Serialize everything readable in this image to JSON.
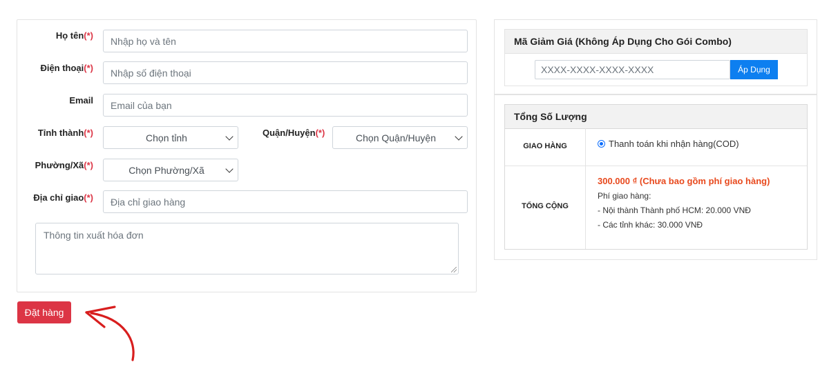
{
  "form": {
    "name_label": "Họ tên",
    "name_placeholder": "Nhập họ và tên",
    "phone_label": "Điện thoại",
    "phone_placeholder": "Nhập số điện thoại",
    "email_label": "Email",
    "email_placeholder": "Email của bạn",
    "province_label": "Tỉnh thành",
    "province_value": "Chọn tỉnh",
    "district_label": "Quận/Huyện",
    "district_value": "Chọn Quận/Huyện",
    "ward_label": "Phường/Xã",
    "ward_value": "Chọn Phường/Xã",
    "address_label": "Địa chỉ giao",
    "address_placeholder": "Địa chỉ giao hàng",
    "invoice_placeholder": "Thông tin xuất hóa đơn",
    "required_mark": "(*)"
  },
  "order_button": "Đặt hàng",
  "coupon": {
    "title": "Mã Giảm Giá (Không Áp Dụng Cho Gói Combo)",
    "placeholder": "XXXX-XXXX-XXXX-XXXX",
    "apply_label": "Áp Dụng"
  },
  "summary": {
    "title": "Tổng Số Lượng",
    "shipping_label": "GIAO HÀNG",
    "payment_option": "Thanh toán khi nhận hàng(COD)",
    "total_label": "TỔNG CỘNG",
    "total_amount": "300.000 ₫ (Chưa bao gồm phí giao hàng)",
    "fee_title": "Phí giao hàng:",
    "fee_hcm": "- Nội thành Thành phố HCM: 20.000 VNĐ",
    "fee_other": "- Các tỉnh khác: 30.000 VNĐ"
  },
  "colors": {
    "required": "#dc3545",
    "order_button": "#dc3545",
    "apply_button": "#0d7ff0",
    "total_amount": "#e8491d",
    "arrow": "#d81e1e"
  },
  "icons": {
    "select_chevron": "chevron-down-icon",
    "annotation_arrow": "curved-arrow-icon"
  }
}
